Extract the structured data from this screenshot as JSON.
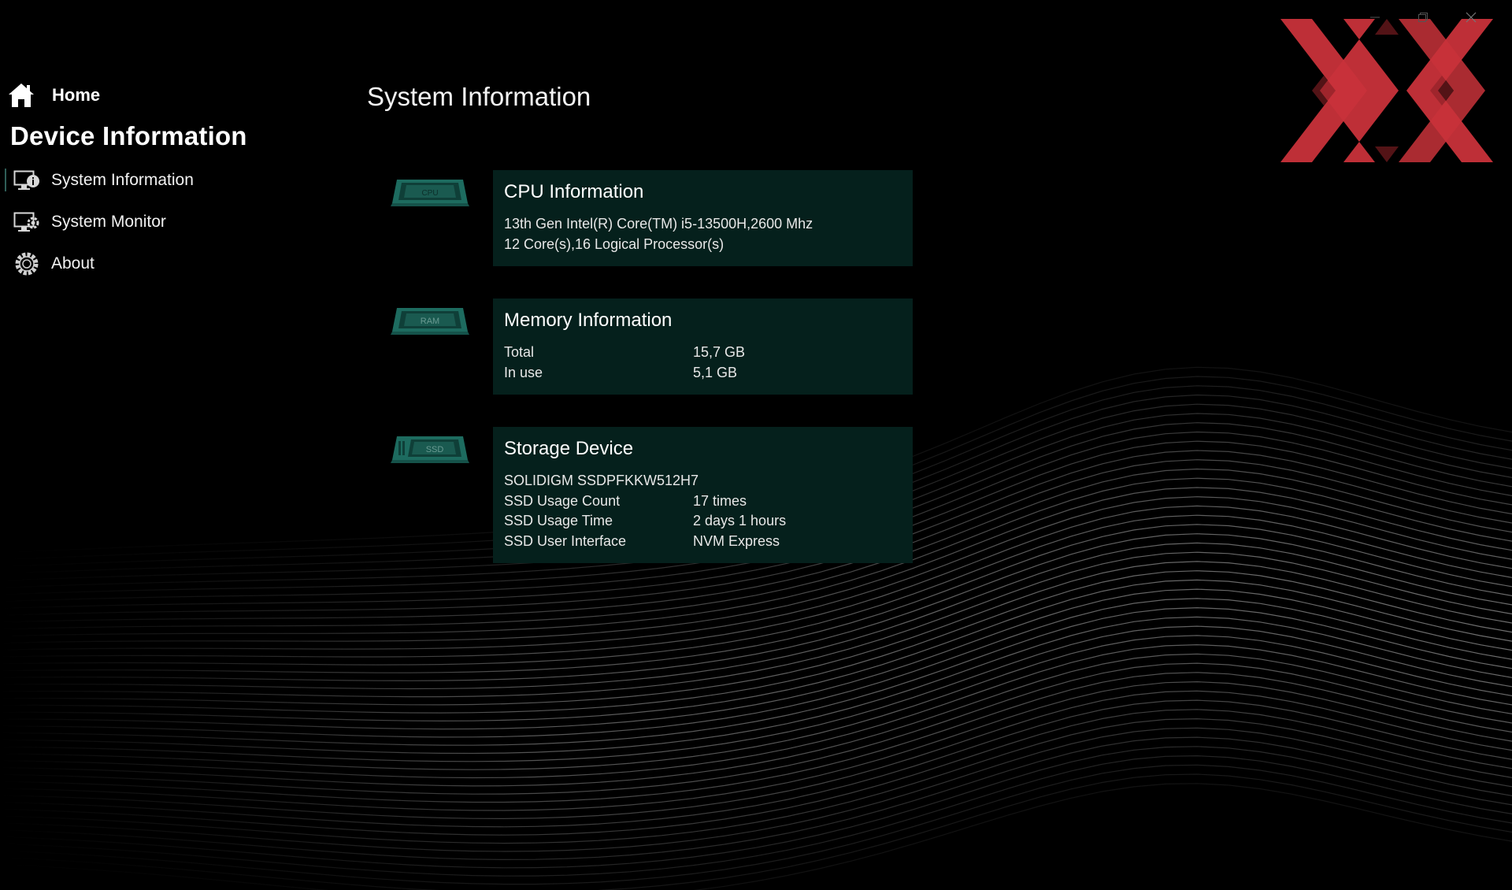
{
  "window": {
    "minimize_icon": "minimize-icon",
    "restore_icon": "restore-icon",
    "close_icon": "close-icon"
  },
  "logo": {
    "text": "XX",
    "color": "#c8323a"
  },
  "sidebar": {
    "home_label": "Home",
    "section_title": "Device Information",
    "items": [
      {
        "label": "System Information",
        "icon": "monitor-info-icon",
        "selected": true
      },
      {
        "label": "System Monitor",
        "icon": "monitor-gear-icon",
        "selected": false
      },
      {
        "label": "About",
        "icon": "gear-icon",
        "selected": false
      }
    ]
  },
  "main": {
    "title": "System Information",
    "cpu": {
      "chip_label": "CPU",
      "title": "CPU Information",
      "model": "13th Gen Intel(R) Core(TM) i5-13500H,2600 Mhz",
      "cores": "12 Core(s),16 Logical Processor(s)"
    },
    "memory": {
      "chip_label": "RAM",
      "title": "Memory Information",
      "rows": [
        {
          "key": "Total",
          "value": "15,7 GB"
        },
        {
          "key": "In use",
          "value": "5,1 GB"
        }
      ]
    },
    "storage": {
      "chip_label": "SSD",
      "title": "Storage Device",
      "model": "SOLIDIGM SSDPFKKW512H7",
      "rows": [
        {
          "key": "SSD Usage Count",
          "value": "17 times"
        },
        {
          "key": "SSD Usage Time",
          "value": "2 days 1 hours"
        },
        {
          "key": "SSD User Interface",
          "value": "NVM Express"
        }
      ]
    }
  },
  "colors": {
    "background": "#000000",
    "card_background": "#05201c",
    "chip_teal": "#1d6b5f",
    "accent_selected": "#2f5e57"
  }
}
